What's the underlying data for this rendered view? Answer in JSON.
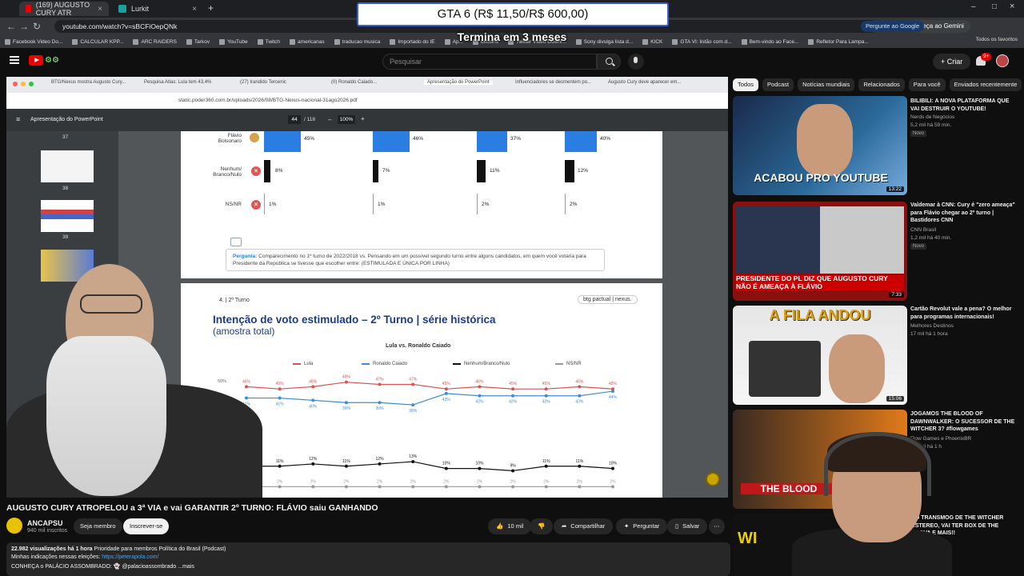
{
  "browser": {
    "tabs": [
      {
        "title": "(169) AUGUSTO CURY ATR",
        "active": true
      },
      {
        "title": "Lurkit",
        "active": false
      }
    ],
    "url": "youtube.com/watch?v=sBCFiOepQNk",
    "gemini_label": "Peça ao Gemini",
    "google_label": "Pergunte ao Google",
    "bookmarks": [
      "Facebook Video Do...",
      "CALCULAR KPP...",
      "ARC RAIDERS",
      "Tarkov",
      "YouTube",
      "Twitch",
      "americanas",
      "traducao musica",
      "Importado do IE",
      "Ap...",
      "bitcoins",
      "Twitter Video Downl...",
      "Sony divulga lista d...",
      "KICK",
      "GTA VI: listão com d...",
      "Bem-vindo ao Face...",
      "Refletor Para Lampa..."
    ],
    "all_favorites": "Todos os favoritos"
  },
  "overlay": {
    "banner": "GTA 6 (R$ 11,50/R$ 600,00)",
    "countdown": "Termina em 3 meses"
  },
  "youtube": {
    "search_placeholder": "Pesquisar",
    "create_label": "Criar",
    "notifications": "9+"
  },
  "inner_browser": {
    "tabs": [
      "BTG/Nexus mostra Augusto Cury...",
      "Pesquisa Atlas: Lula tem 43,4%",
      "(27) Irandido Tercenic",
      "(0) Ronaldo Caiado...",
      "Apresentação do PowerPoint",
      "Influenciadores se desmentem po...",
      "Augusto Cury deve aparecer em..."
    ],
    "url": "static.poder360.com.br/uploads/2026/08/BTG-Nexus-nacional-31ago2026.pdf",
    "pdf_title": "Apresentação do PowerPoint",
    "page": "44",
    "total": "/ 118",
    "zoom": "100%",
    "thumb_numbers": [
      "37",
      "38",
      "39"
    ]
  },
  "slide1": {
    "rows": [
      {
        "label": "Flávio Bolsonaro",
        "values": [
          "45%",
          "46%",
          "37%",
          "40%"
        ]
      },
      {
        "label": "Nenhum/ Branco/Nulo",
        "values": [
          "8%",
          "7%",
          "11%",
          "12%"
        ]
      },
      {
        "label": "NS/NR",
        "values": [
          "1%",
          "1%",
          "2%",
          "2%"
        ]
      }
    ],
    "question_bold": "Pergunta:",
    "question_text": "Comparecimento no 1º turno de 2022/2018 vs. Pensando em um possível segundo turno entre alguns candidatos, em quem você votaria para Presidente da República se tivesse que escolher entre: (ESTIMULADA E ÚNICA POR LINHA)"
  },
  "slide2": {
    "tag": "4. | 2º Turno",
    "logo": "btg pactual | nexus.",
    "title": "Intenção de voto estimulado – 2º Turno | série histórica",
    "subtitle": "(amostra total)",
    "caption": "Lula vs. Ronaldo Caiado",
    "legend": [
      "Lula",
      "Ronaldo Caiado",
      "Nenhum/Branco/Nulo",
      "NS/NR"
    ],
    "ytick": "50%"
  },
  "chart_data": {
    "type": "line",
    "title": "Intenção de voto estimulado – 2º Turno | série histórica",
    "subtitle": "(amostra total)",
    "series": [
      {
        "name": "Lula",
        "color": "#d9534f",
        "values": [
          46,
          45,
          46,
          48,
          47,
          47,
          45,
          46,
          45,
          45,
          46,
          45
        ]
      },
      {
        "name": "Ronaldo Caiado",
        "color": "#3b8ed8",
        "values": [
          41,
          41,
          40,
          39,
          39,
          38,
          43,
          42,
          42,
          42,
          42,
          44
        ]
      },
      {
        "name": "Nenhum/Branco/Nulo",
        "color": "#111111",
        "values": [
          11,
          11,
          12,
          11,
          12,
          13,
          10,
          10,
          9,
          11,
          11,
          10
        ]
      },
      {
        "name": "NS/NR",
        "color": "#999999",
        "values": [
          2,
          2,
          2,
          2,
          2,
          2,
          2,
          2,
          2,
          2,
          2,
          2
        ]
      }
    ],
    "ylim": [
      0,
      50
    ]
  },
  "video": {
    "title": "AUGUSTO CURY ATROPELOU a 3ª VIA e vai GARANTIR 2º TURNO: FLÁVIO saiu GANHANDO",
    "channel": "ANCAPSU",
    "subscribers": "940 mil inscritos",
    "member_label": "Seja membro",
    "subscribe_label": "Inscrever-se",
    "likes": "10 mil",
    "share_label": "Compartilhar",
    "ask_label": "Perguntar",
    "save_label": "Salvar",
    "desc_views": "22.982 visualizações",
    "desc_time": "há 1 hora",
    "desc_tags": "Prioridade para membros  Política do Brasil (Podcast)",
    "desc_line2": "Minhas indicações nessas eleições:",
    "desc_link": "https://peterapola.com/",
    "desc_line3": "CONHEÇA o PALÁCIO ASSOMBRADO: 👻 @palacioassombrado  ...mais"
  },
  "sidebar": {
    "chips": [
      "Todos",
      "Podcast",
      "Notícias mundiais",
      "Relacionados",
      "Para você",
      "Enviados recentemente"
    ],
    "recs": [
      {
        "title": "BILIBILI: A NOVA PLATAFORMA QUE VAI DESTRUIR O YOUTUBE!",
        "channel": "Nerds de Negócios",
        "meta": "5,2 mil  há 59 min.",
        "badge": "Novo",
        "duration": "13:22",
        "overlay": "ACABOU PRO YOUTUBE"
      },
      {
        "title": "Valdemar à CNN: Cury é \"zero ameaça\" para Flávio chegar ao 2º turno | Bastidores CNN",
        "channel": "CNN Brasil",
        "meta": "1,2 mil  há 40 min.",
        "badge": "Novo",
        "duration": "7:33",
        "overlay": "PRESIDENTE DO PL DIZ QUE AUGUSTO CURY NÃO É AMEAÇA À FLÁVIO"
      },
      {
        "title": "Cartão Revolut vale a pena? O melhor para programas internacionais!",
        "channel": "Melhores Destinos",
        "meta": "17 mil  há 1 hora",
        "duration": "15:06",
        "overlay": "A FILA ANDOU"
      },
      {
        "title": "JOGAMOS THE BLOOD OF DAWNWALKER: O SUCESSOR DE THE WITCHER 3? #flowgames",
        "channel": "Flow Games e PhoenixBR",
        "meta": "3,8 mil  há 1 h",
        "overlay": "THE BLOOD"
      },
      {
        "title": "...O TRANSMOG DE THE WITCHER ...STEREO, VAI TER BOX DE THE ...NOVA E MAIS!!",
        "overlay": "WI"
      }
    ]
  }
}
